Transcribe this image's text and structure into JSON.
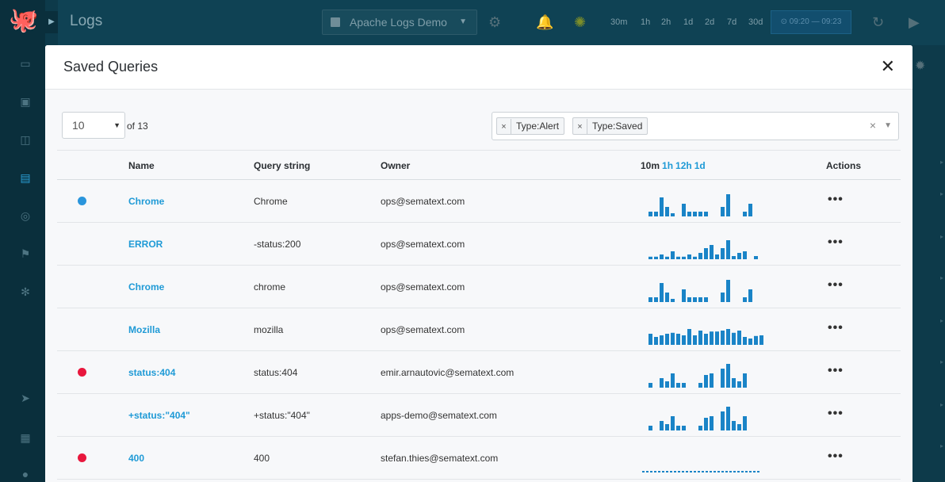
{
  "app": {
    "title": "Logs",
    "app_select": "Apache Logs Demo",
    "time_buttons": [
      "30m",
      "1h",
      "2h",
      "1d",
      "2d",
      "7d",
      "30d"
    ],
    "time_range": "09:20 — 09:23"
  },
  "modal": {
    "title": "Saved Queries",
    "close_label": "✕",
    "page_size": "10",
    "page_of": "of 13",
    "filters": [
      {
        "remove": "×",
        "label": "Type:Alert"
      },
      {
        "remove": "×",
        "label": "Type:Saved"
      }
    ],
    "filter_clear": "×"
  },
  "table": {
    "headers": {
      "name": "Name",
      "query": "Query string",
      "owner": "Owner",
      "spark_ranges": [
        "10m",
        "1h",
        "12h",
        "1d"
      ],
      "actions": "Actions"
    },
    "rows": [
      {
        "dot": "#2a95dc",
        "name": "Chrome",
        "query": "Chrome",
        "owner": "ops@sematext.com",
        "actions": "•••",
        "spark": [
          0.15,
          0.15,
          0.6,
          0.3,
          0.1,
          0,
          0.4,
          0.15,
          0.15,
          0.15,
          0.15,
          0,
          0,
          0.3,
          0.7,
          0,
          0,
          0.15,
          0.4
        ]
      },
      {
        "dot": null,
        "name": "ERROR",
        "query": "-status:200",
        "owner": "ops@sematext.com",
        "actions": "•••",
        "spark": [
          0.08,
          0.08,
          0.15,
          0.08,
          0.25,
          0.08,
          0.08,
          0.15,
          0.08,
          0.2,
          0.35,
          0.45,
          0.15,
          0.35,
          0.6,
          0.1,
          0.2,
          0.25,
          0,
          0.1
        ]
      },
      {
        "dot": null,
        "name": "Chrome",
        "query": "chrome",
        "owner": "ops@sematext.com",
        "actions": "•••",
        "spark": [
          0.15,
          0.15,
          0.6,
          0.3,
          0.1,
          0,
          0.4,
          0.15,
          0.15,
          0.15,
          0.15,
          0,
          0,
          0.3,
          0.7,
          0,
          0,
          0.15,
          0.4
        ]
      },
      {
        "dot": null,
        "name": "Mozilla",
        "query": "mozilla",
        "owner": "ops@sematext.com",
        "actions": "•••",
        "spark": [
          0.35,
          0.25,
          0.3,
          0.35,
          0.38,
          0.35,
          0.3,
          0.5,
          0.3,
          0.45,
          0.35,
          0.42,
          0.42,
          0.45,
          0.5,
          0.38,
          0.45,
          0.25,
          0.2,
          0.28,
          0.3
        ]
      },
      {
        "dot": "#e8173d",
        "name": "status:404",
        "query": "status:404",
        "owner": "emir.arnautovic@sematext.com",
        "actions": "•••",
        "spark": [
          0.15,
          0,
          0.3,
          0.2,
          0.45,
          0.15,
          0.15,
          0,
          0,
          0.15,
          0.4,
          0.45,
          0,
          0.6,
          0.75,
          0.3,
          0.2,
          0.45
        ]
      },
      {
        "dot": null,
        "name": "+status:\"404\"",
        "query": "+status:\"404\"",
        "owner": "apps-demo@sematext.com",
        "actions": "•••",
        "spark": [
          0.15,
          0,
          0.3,
          0.2,
          0.45,
          0.15,
          0.15,
          0,
          0,
          0.15,
          0.4,
          0.45,
          0,
          0.6,
          0.75,
          0.3,
          0.2,
          0.45
        ]
      },
      {
        "dot": "#e8173d",
        "name": "400",
        "query": "400",
        "owner": "stefan.thies@sematext.com",
        "actions": "•••",
        "spark_dashed": true,
        "spark": []
      }
    ]
  },
  "colors": {
    "accent": "#1f9ad6",
    "bar": "#1a84c7",
    "alert_red": "#e8173d",
    "alert_blue": "#2a95dc"
  }
}
